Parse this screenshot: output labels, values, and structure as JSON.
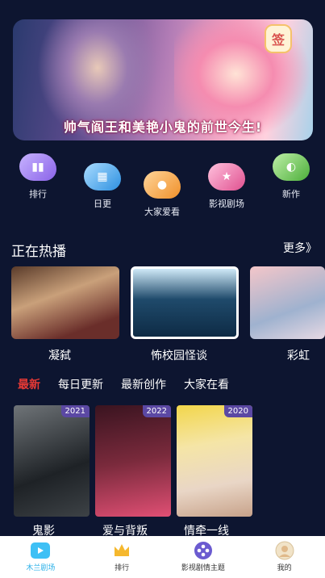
{
  "banner": {
    "caption": "帅气阎王和美艳小鬼的前世今生!",
    "sign": "签"
  },
  "categories": [
    {
      "label": "排行",
      "color": "#9b7cf0",
      "icon": "ranking-icon"
    },
    {
      "label": "日更",
      "color": "#3aa8f0",
      "icon": "calendar-icon"
    },
    {
      "label": "大家爱看",
      "color": "#f5a53a",
      "icon": "chat-bubble-icon"
    },
    {
      "label": "影视剧场",
      "color": "#f07ab0",
      "icon": "star-icon"
    },
    {
      "label": "新作",
      "color": "#6cc65a",
      "icon": "new-badge-icon"
    }
  ],
  "hot": {
    "title": "正在热播",
    "more": "更多》",
    "items": [
      {
        "title": "凝弑"
      },
      {
        "title": "怖校园怪谈"
      },
      {
        "title": "彩虹"
      }
    ]
  },
  "tabs": [
    {
      "label": "最新",
      "active": true
    },
    {
      "label": "每日更新",
      "active": false
    },
    {
      "label": "最新创作",
      "active": false
    },
    {
      "label": "大家在看",
      "active": false
    }
  ],
  "posters": [
    {
      "title": "鬼影",
      "year": "2021"
    },
    {
      "title": "爱与背叛",
      "year": "2022"
    },
    {
      "title": "情牵一线",
      "year": "2020"
    }
  ],
  "nav": [
    {
      "label": "木兰剧场",
      "icon": "home-tv-icon",
      "active": true
    },
    {
      "label": "排行",
      "icon": "crown-icon",
      "active": false
    },
    {
      "label": "影视剧情主题",
      "icon": "film-reel-icon",
      "active": false
    },
    {
      "label": "我的",
      "icon": "avatar-icon",
      "active": false
    }
  ]
}
